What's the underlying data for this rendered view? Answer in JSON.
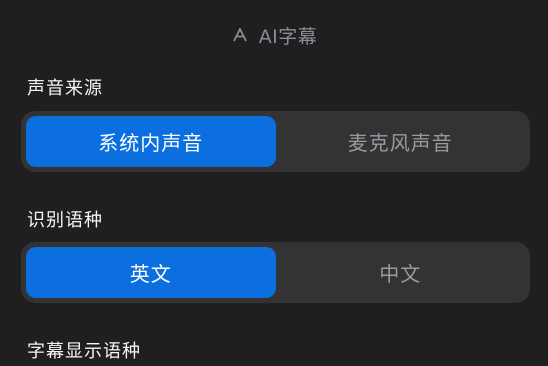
{
  "header": {
    "title": "AI字幕",
    "icon": "ai-subtitle-icon"
  },
  "sections": [
    {
      "label": "声音来源",
      "options": [
        "系统内声音",
        "麦克风声音"
      ],
      "selected": "系统内声音"
    },
    {
      "label": "识别语种",
      "options": [
        "英文",
        "中文"
      ],
      "selected": "英文"
    },
    {
      "label": "字幕显示语种"
    }
  ],
  "colors": {
    "background": "#1f1f21",
    "segment_background": "#333336",
    "accent": "#0b6fe0",
    "inactive_text": "#9a9a9d"
  }
}
